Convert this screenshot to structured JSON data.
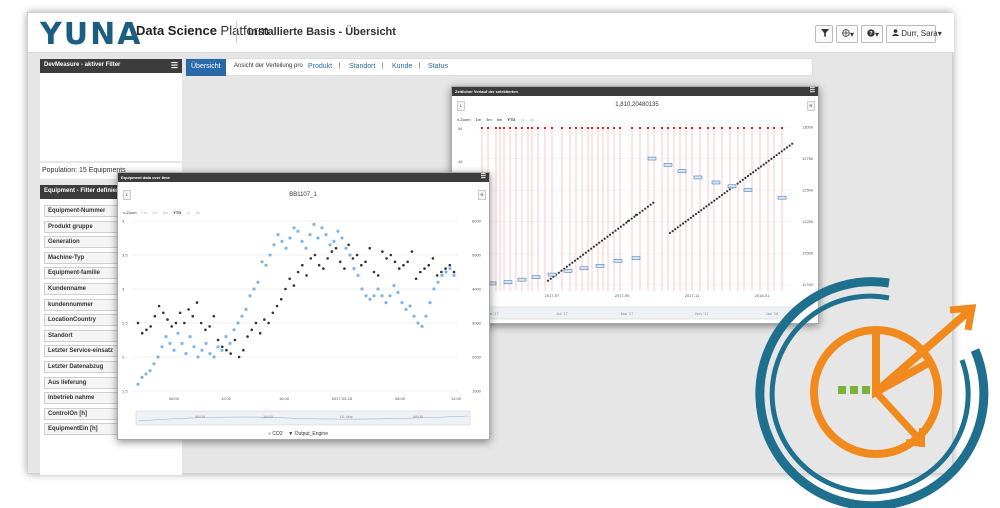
{
  "header": {
    "logo": "YUNA",
    "platform_bold": "Data Science",
    "platform_rest": " Platform",
    "page_title": "Installierte Basis - Übersicht",
    "filter_icon": "filter-icon",
    "globe_caret": "▾",
    "help_caret": "▾",
    "user": "Durr, Sara",
    "user_caret": "▾"
  },
  "left_panel": {
    "filter_title": "DevMeasure - aktiver Filter",
    "population": "Population: 15 Equipments",
    "equipment_title": "Equipment - Filter definieren",
    "filters": [
      "Equipment-Nummer",
      "Produkt gruppe",
      "Generation",
      "Machine-Typ",
      "Equipment-familie",
      "Kundenname",
      "kundennummer",
      "LocationCountry",
      "Standort",
      "Letzter Service-einsatz",
      "Letzter Datenabzug",
      "Aus lieferung",
      "Inbetrieb nahme",
      "ControlOn [h]",
      "EquipmentEin [h]"
    ]
  },
  "nav": {
    "active": "Übersicht",
    "label": "Ansicht der Verteilung pro",
    "links": [
      "Produkt",
      "Standort",
      "Kunde",
      "Status"
    ],
    "divider": "|"
  },
  "window_back": {
    "title": "Zeitlicher Verlauf der selektierten",
    "chart_title": "1,810,20480135",
    "btn_left": "L",
    "btn_right": "R",
    "zoom_label": "x-Zoom",
    "zoom": [
      "1m",
      "3m",
      "6m",
      "YTD",
      "1y",
      "All"
    ],
    "zoom_dim": [
      false,
      false,
      false,
      false,
      true,
      true
    ],
    "y_left_ticks": [
      "54",
      "46"
    ],
    "y_right_ticks": [
      "13000",
      "12750",
      "12500",
      "12250",
      "12000",
      "11750"
    ],
    "x_ticks": [
      "2017-07",
      "2017-09",
      "2017-11",
      "2018-01"
    ],
    "nav_ticks": [
      "Mar '17",
      "Jul '17",
      "Mai '17",
      "Nov '17",
      "Jan '18"
    ],
    "colors": {
      "threshold": "#e8231f",
      "trend": "#333333",
      "box": "#2a6aa8"
    }
  },
  "window_front": {
    "title": "Equipment data over time",
    "chart_title": "BB1107_1",
    "btn_left": "L",
    "btn_right": "R",
    "zoom_label": "x-Zoom",
    "zoom": [
      "1m",
      "3m",
      "6m",
      "YTD",
      "1y",
      "All"
    ],
    "zoom_dim": [
      true,
      true,
      true,
      false,
      true,
      true
    ],
    "y_left_ticks": [
      "4",
      "3.5",
      "3",
      "2.5",
      "2",
      "1.5"
    ],
    "y_right_ticks": [
      "6000",
      "5000",
      "4000",
      "3000",
      "2000",
      "1000"
    ],
    "x_ticks": [
      "08:00",
      "12:00",
      "16:00",
      "2017-05-15",
      "08:00",
      "12:00"
    ],
    "nav_ticks": [
      "08:00",
      "16:00",
      "15. Mai",
      "08:00"
    ],
    "legend": {
      "co2": "CO2",
      "engine": "Output_Engine"
    },
    "colors": {
      "co2": "#7fb6e8",
      "engine": "#333333"
    }
  },
  "emblem": {
    "colors": {
      "ring": "#1f6f8f",
      "accent": "#f08a1c",
      "dots": "#7bb33a"
    }
  },
  "chart_data": [
    {
      "type": "scatter",
      "title": "BB1107_1",
      "series": [
        {
          "name": "CO2",
          "axis": "left",
          "y": [
            1.6,
            1.7,
            1.75,
            1.8,
            1.9,
            2.0,
            2.15,
            2.3,
            2.2,
            2.1,
            2.35,
            2.2,
            2.05,
            2.3,
            2.15,
            2.0,
            2.1,
            2.2,
            2.05,
            2.0,
            2.15,
            2.1,
            2.3,
            2.2,
            2.4,
            2.5,
            2.6,
            2.7,
            2.9,
            3.0,
            3.1,
            3.4,
            3.35,
            3.5,
            3.65,
            3.8,
            3.7,
            3.6,
            3.75,
            3.9,
            3.85,
            3.7,
            3.6,
            3.8,
            3.95,
            3.75,
            3.9,
            3.8,
            3.65,
            3.7,
            3.85,
            3.75,
            3.6,
            3.5,
            3.3,
            3.2,
            3.0,
            2.9,
            2.85,
            2.9,
            3.0,
            2.9,
            2.8,
            2.9,
            3.05,
            2.95,
            2.8,
            2.7,
            2.75,
            2.6,
            2.5,
            2.45,
            2.6,
            2.8,
            3.0,
            3.1,
            3.2,
            3.25,
            3.3,
            3.2
          ]
        },
        {
          "name": "Output_Engine",
          "axis": "right",
          "y": [
            3000,
            2700,
            2800,
            2900,
            3200,
            3500,
            3300,
            3100,
            2900,
            3000,
            3300,
            3000,
            3400,
            3200,
            3600,
            3000,
            2800,
            2900,
            3200,
            2500,
            2300,
            2200,
            2100,
            2500,
            2000,
            2200,
            2600,
            2800,
            3000,
            2700,
            3100,
            3000,
            3300,
            3500,
            3700,
            4000,
            4300,
            4100,
            4500,
            4700,
            4400,
            4900,
            5000,
            4700,
            4600,
            4900,
            5100,
            5200,
            4800,
            4600,
            5300,
            4900,
            5000,
            4700,
            4800,
            5200,
            4500,
            4400,
            5100,
            4900,
            5000,
            4800,
            4600,
            4700,
            4800,
            5100,
            4300,
            4500,
            4600,
            4700,
            4900,
            4400,
            4500,
            4600,
            4700,
            4500
          ]
        }
      ],
      "ylim_left": [
        1.5,
        4
      ],
      "ylim_right": [
        1000,
        6000
      ]
    },
    {
      "type": "scatter",
      "title": "1,810,20480135",
      "series": [
        {
          "name": "trend",
          "axis": "right",
          "x_start": "2017-06",
          "y_start": 11750,
          "y_end": 12900
        },
        {
          "name": "boxes",
          "axis": "right",
          "y": [
            11760,
            11770,
            11790,
            11810,
            11830,
            11860,
            11880,
            11900,
            11940,
            11960,
            12750,
            12700,
            12650,
            12600,
            12560,
            12530,
            12500,
            12440
          ]
        }
      ],
      "ylim_right": [
        11700,
        13000
      ]
    }
  ]
}
